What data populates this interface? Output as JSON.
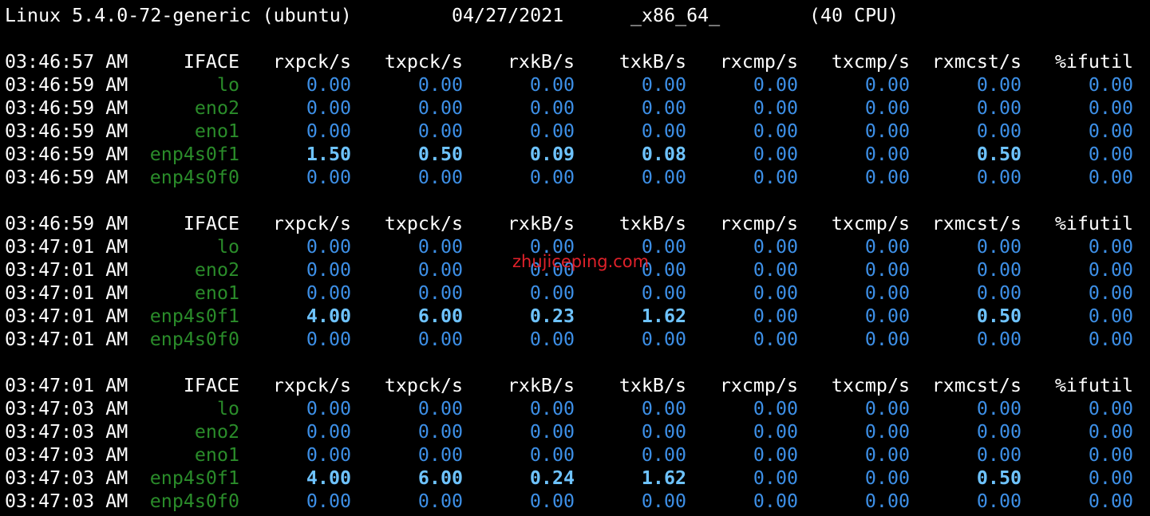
{
  "sysinfo": {
    "kernel": "Linux 5.4.0-72-generic (ubuntu)",
    "date": "04/27/2021",
    "arch": "_x86_64_",
    "cpus": "(40 CPU)"
  },
  "headers": [
    "IFACE",
    "rxpck/s",
    "txpck/s",
    "rxkB/s",
    "txkB/s",
    "rxcmp/s",
    "txcmp/s",
    "rxmcst/s",
    "%ifutil"
  ],
  "blocks": [
    {
      "header_time": "03:46:57 AM",
      "rows": [
        {
          "time": "03:46:59 AM",
          "iface": "lo",
          "values": [
            "0.00",
            "0.00",
            "0.00",
            "0.00",
            "0.00",
            "0.00",
            "0.00",
            "0.00"
          ]
        },
        {
          "time": "03:46:59 AM",
          "iface": "eno2",
          "values": [
            "0.00",
            "0.00",
            "0.00",
            "0.00",
            "0.00",
            "0.00",
            "0.00",
            "0.00"
          ]
        },
        {
          "time": "03:46:59 AM",
          "iface": "eno1",
          "values": [
            "0.00",
            "0.00",
            "0.00",
            "0.00",
            "0.00",
            "0.00",
            "0.00",
            "0.00"
          ]
        },
        {
          "time": "03:46:59 AM",
          "iface": "enp4s0f1",
          "values": [
            "1.50",
            "0.50",
            "0.09",
            "0.08",
            "0.00",
            "0.00",
            "0.50",
            "0.00"
          ]
        },
        {
          "time": "03:46:59 AM",
          "iface": "enp4s0f0",
          "values": [
            "0.00",
            "0.00",
            "0.00",
            "0.00",
            "0.00",
            "0.00",
            "0.00",
            "0.00"
          ]
        }
      ]
    },
    {
      "header_time": "03:46:59 AM",
      "rows": [
        {
          "time": "03:47:01 AM",
          "iface": "lo",
          "values": [
            "0.00",
            "0.00",
            "0.00",
            "0.00",
            "0.00",
            "0.00",
            "0.00",
            "0.00"
          ]
        },
        {
          "time": "03:47:01 AM",
          "iface": "eno2",
          "values": [
            "0.00",
            "0.00",
            "0.00",
            "0.00",
            "0.00",
            "0.00",
            "0.00",
            "0.00"
          ]
        },
        {
          "time": "03:47:01 AM",
          "iface": "eno1",
          "values": [
            "0.00",
            "0.00",
            "0.00",
            "0.00",
            "0.00",
            "0.00",
            "0.00",
            "0.00"
          ]
        },
        {
          "time": "03:47:01 AM",
          "iface": "enp4s0f1",
          "values": [
            "4.00",
            "6.00",
            "0.23",
            "1.62",
            "0.00",
            "0.00",
            "0.50",
            "0.00"
          ]
        },
        {
          "time": "03:47:01 AM",
          "iface": "enp4s0f0",
          "values": [
            "0.00",
            "0.00",
            "0.00",
            "0.00",
            "0.00",
            "0.00",
            "0.00",
            "0.00"
          ]
        }
      ]
    },
    {
      "header_time": "03:47:01 AM",
      "rows": [
        {
          "time": "03:47:03 AM",
          "iface": "lo",
          "values": [
            "0.00",
            "0.00",
            "0.00",
            "0.00",
            "0.00",
            "0.00",
            "0.00",
            "0.00"
          ]
        },
        {
          "time": "03:47:03 AM",
          "iface": "eno2",
          "values": [
            "0.00",
            "0.00",
            "0.00",
            "0.00",
            "0.00",
            "0.00",
            "0.00",
            "0.00"
          ]
        },
        {
          "time": "03:47:03 AM",
          "iface": "eno1",
          "values": [
            "0.00",
            "0.00",
            "0.00",
            "0.00",
            "0.00",
            "0.00",
            "0.00",
            "0.00"
          ]
        },
        {
          "time": "03:47:03 AM",
          "iface": "enp4s0f1",
          "values": [
            "4.00",
            "6.00",
            "0.24",
            "1.62",
            "0.00",
            "0.00",
            "0.50",
            "0.00"
          ]
        },
        {
          "time": "03:47:03 AM",
          "iface": "enp4s0f0",
          "values": [
            "0.00",
            "0.00",
            "0.00",
            "0.00",
            "0.00",
            "0.00",
            "0.00",
            "0.00"
          ]
        }
      ]
    }
  ],
  "watermark": "zhujiceping.com",
  "colors": {
    "background": "#000000",
    "text": "#ffffff",
    "iface": "#2a8c2a",
    "value": "#3d8fe6",
    "value_highlight": "#6ec3ff",
    "watermark": "#e0212a"
  }
}
